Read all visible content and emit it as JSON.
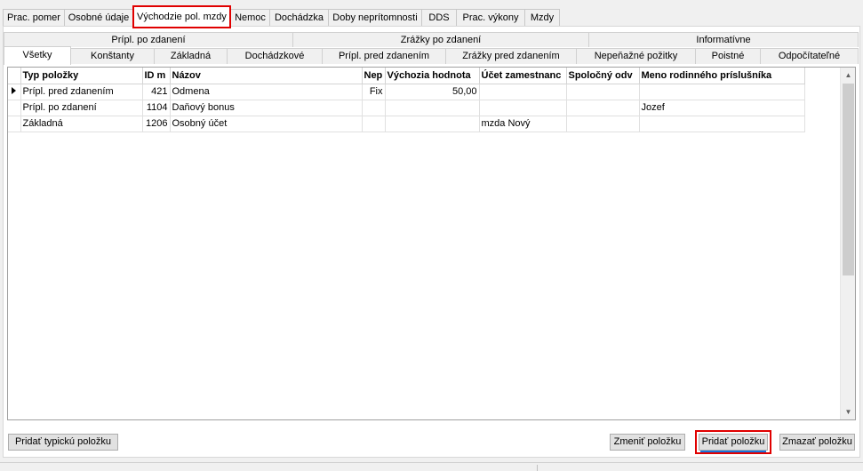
{
  "top_tabs": [
    {
      "label": "Prac. pomer"
    },
    {
      "label": "Osobné údaje"
    },
    {
      "label": "Východzie pol. mzdy",
      "active": true
    },
    {
      "label": "Nemoc"
    },
    {
      "label": "Dochádzka"
    },
    {
      "label": "Doby neprítomnosti"
    },
    {
      "label": "DDS"
    },
    {
      "label": "Prac. výkony"
    },
    {
      "label": "Mzdy"
    }
  ],
  "category_tabs": [
    {
      "label": "Prípl. po zdanení"
    },
    {
      "label": "Zrážky po zdanení"
    },
    {
      "label": "Informatívne"
    }
  ],
  "sub_tabs": [
    {
      "label": "Všetky",
      "active": true
    },
    {
      "label": "Konštanty"
    },
    {
      "label": "Základná"
    },
    {
      "label": "Dochádzkové"
    },
    {
      "label": "Prípl. pred zdanením"
    },
    {
      "label": "Zrážky pred zdanením"
    },
    {
      "label": "Nepeňažné požitky"
    },
    {
      "label": "Poistné"
    },
    {
      "label": "Odpočítateľné"
    }
  ],
  "grid": {
    "columns": [
      "Typ položky",
      "ID m",
      "Názov",
      "Nep",
      "Výchozia hodnota",
      "Účet zamestnanc",
      "Spoločný odv",
      "Meno rodinného príslušníka"
    ],
    "rows": [
      {
        "current": true,
        "cells": [
          "Prípl. pred zdanením",
          "421",
          "Odmena",
          "Fix",
          "50,00",
          "",
          "",
          ""
        ]
      },
      {
        "current": false,
        "cells": [
          "Prípl. po zdanení",
          "1104",
          "Daňový bonus",
          "",
          "",
          "",
          "",
          "Jozef"
        ]
      },
      {
        "current": false,
        "cells": [
          "Základná",
          "1206",
          "Osobný účet",
          "",
          "",
          "mzda Nový",
          "",
          ""
        ]
      }
    ]
  },
  "buttons": {
    "add_typical": "Pridať typickú položku",
    "change": "Zmeniť položku",
    "add": "Pridať položku",
    "delete": "Zmazať položku"
  },
  "icons": {
    "scroll_up": "scroll-up-arrow-icon",
    "scroll_down": "scroll-down-arrow-icon",
    "row_pointer": "current-row-pointer-icon"
  },
  "colors": {
    "highlight": "#e00000",
    "focus_underline": "#1a73d9"
  }
}
